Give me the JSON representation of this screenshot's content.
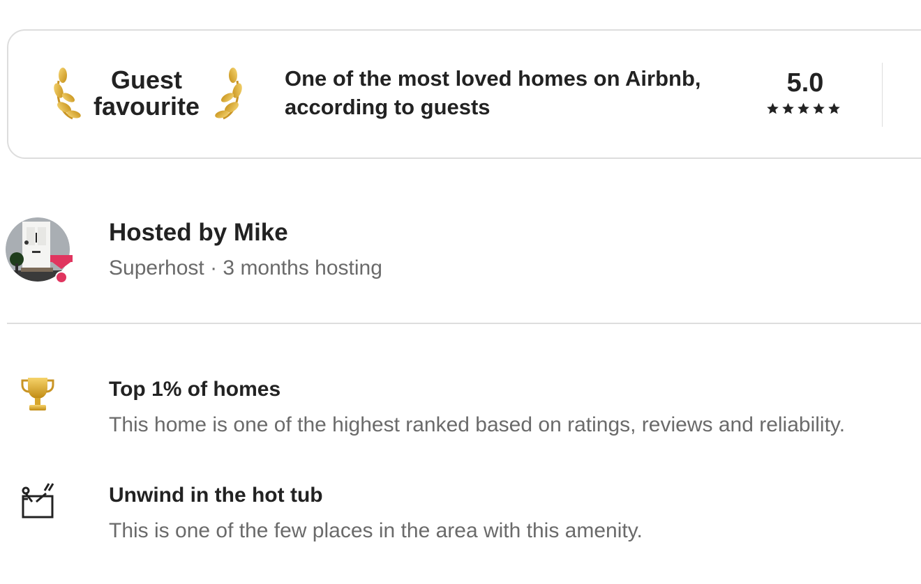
{
  "guest_favourite": {
    "badge_title": "Guest favourite",
    "description": "One of the most loved homes on Airbnb, according to guests",
    "rating": "5.0",
    "stars": 5
  },
  "host": {
    "name_line": "Hosted by Mike",
    "meta_line": "Superhost · 3 months hosting"
  },
  "highlights": [
    {
      "icon": "trophy-icon",
      "title": "Top 1% of homes",
      "description": "This home is one of the highest ranked based on ratings, reviews and reliability."
    },
    {
      "icon": "hot-tub-icon",
      "title": "Unwind in the hot tub",
      "description": "This is one of the few places in the area with this amenity."
    }
  ],
  "colors": {
    "text_primary": "#222222",
    "text_secondary": "#6a6a6a",
    "border": "#dddddd",
    "laurel_gold": "#d9a92c",
    "superhost_pink": "#e0355f"
  }
}
